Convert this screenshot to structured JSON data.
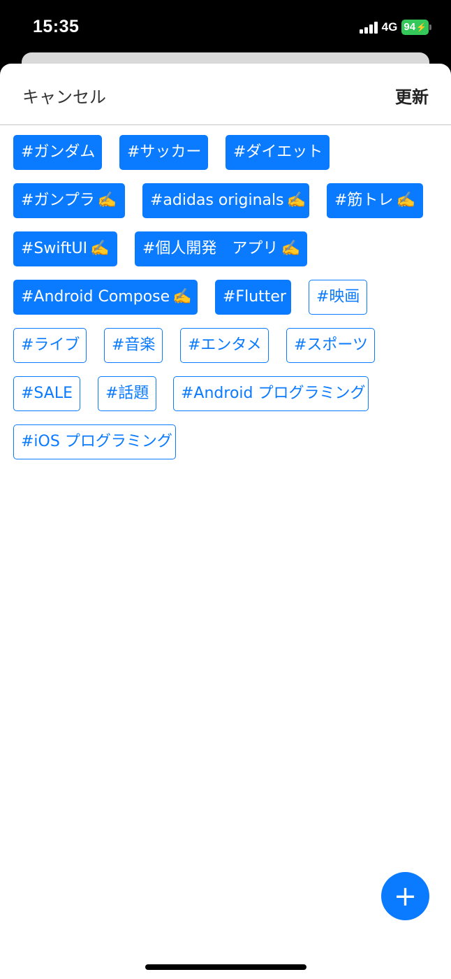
{
  "status_bar": {
    "time": "15:35",
    "network": "4G",
    "battery": "94",
    "battery_color": "#34c759"
  },
  "nav": {
    "cancel_label": "キャンセル",
    "update_label": "更新"
  },
  "tags": [
    {
      "label": "#ガンダム",
      "selected": true,
      "editable": false
    },
    {
      "label": "#サッカー",
      "selected": true,
      "editable": false
    },
    {
      "label": "#ダイエット",
      "selected": true,
      "editable": false
    },
    {
      "label": "#ガンプラ",
      "selected": true,
      "editable": true
    },
    {
      "label": "#adidas originals",
      "selected": true,
      "editable": true
    },
    {
      "label": "#筋トレ",
      "selected": true,
      "editable": true
    },
    {
      "label": "#SwiftUI",
      "selected": true,
      "editable": true
    },
    {
      "label": "#個人開発　アプリ",
      "selected": true,
      "editable": true
    },
    {
      "label": "#Android Compose",
      "selected": true,
      "editable": true
    },
    {
      "label": "#Flutter",
      "selected": true,
      "editable": false
    },
    {
      "label": "#映画",
      "selected": false,
      "editable": false
    },
    {
      "label": "#ライブ",
      "selected": false,
      "editable": false
    },
    {
      "label": "#音楽",
      "selected": false,
      "editable": false
    },
    {
      "label": "#エンタメ",
      "selected": false,
      "editable": false
    },
    {
      "label": "#スポーツ",
      "selected": false,
      "editable": false
    },
    {
      "label": "#SALE",
      "selected": false,
      "editable": false
    },
    {
      "label": "#話題",
      "selected": false,
      "editable": false
    },
    {
      "label": "#Android プログラミング",
      "selected": false,
      "editable": false
    },
    {
      "label": "#iOS プログラミング",
      "selected": false,
      "editable": false
    }
  ],
  "edit_icon": "✍️",
  "fab": {
    "icon": "plus-icon",
    "glyph": "+"
  },
  "colors": {
    "accent": "#0a7aff"
  }
}
